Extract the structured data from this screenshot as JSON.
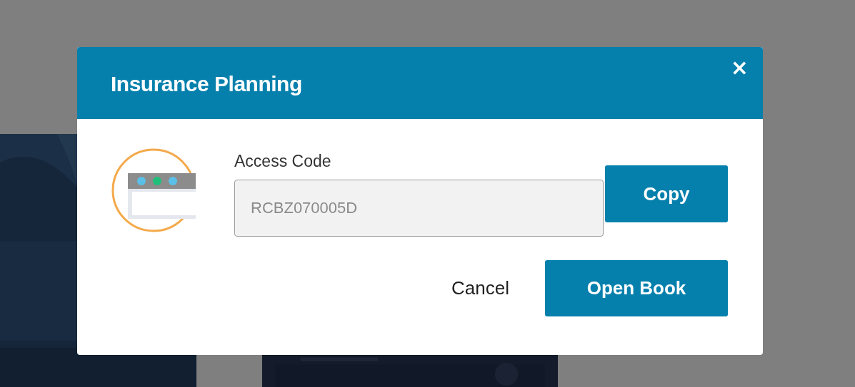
{
  "dialog": {
    "title": "Insurance Planning",
    "close": "×",
    "field": {
      "label": "Access Code",
      "value": "RCBZ070005D",
      "disabled": true
    },
    "copy_button": "Copy",
    "buttons": [
      {
        "label": "Cancel",
        "kind": "text"
      },
      {
        "label": "Open Book",
        "kind": "primary"
      }
    ]
  }
}
